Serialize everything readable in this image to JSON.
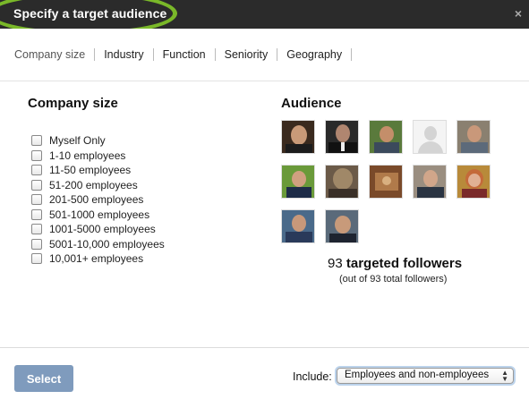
{
  "dialog": {
    "title": "Specify a target audience",
    "close_glyph": "×"
  },
  "tabs": [
    {
      "label": "Company size"
    },
    {
      "label": "Industry"
    },
    {
      "label": "Function"
    },
    {
      "label": "Seniority"
    },
    {
      "label": "Geography"
    }
  ],
  "company_size": {
    "heading": "Company size",
    "options": [
      {
        "label": "Myself Only"
      },
      {
        "label": "1-10 employees"
      },
      {
        "label": "11-50 employees"
      },
      {
        "label": "51-200 employees"
      },
      {
        "label": "201-500 employees"
      },
      {
        "label": "501-1000 employees"
      },
      {
        "label": "1001-5000 employees"
      },
      {
        "label": "5001-10,000 employees"
      },
      {
        "label": "10,001+ employees"
      }
    ]
  },
  "audience": {
    "heading": "Audience",
    "count": "93",
    "count_label": "targeted followers",
    "total_note": "(out of 93 total followers)"
  },
  "footer": {
    "select_label": "Select",
    "include_label": "Include:",
    "include_value": "Employees and non-employees"
  }
}
